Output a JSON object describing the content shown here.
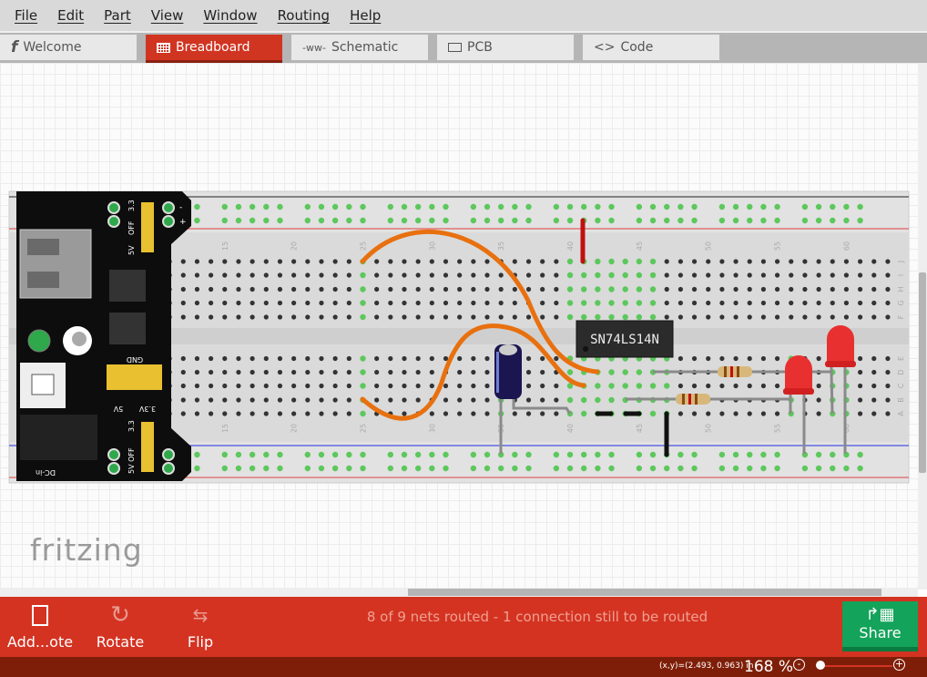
{
  "menu": [
    "File",
    "Edit",
    "Part",
    "View",
    "Window",
    "Routing",
    "Help"
  ],
  "tabs": [
    {
      "label": "Welcome",
      "icon": "fritzing-f-icon",
      "active": false
    },
    {
      "label": "Breadboard",
      "icon": "breadboard-icon",
      "active": true
    },
    {
      "label": "Schematic",
      "icon": "resistor-symbol-icon",
      "active": false
    },
    {
      "label": "PCB",
      "icon": "pcb-icon",
      "active": false
    },
    {
      "label": "Code",
      "icon": "code-brackets-icon",
      "active": false
    }
  ],
  "canvas": {
    "logo": "fritzing",
    "ic_label": "SN74LS14N",
    "column_numbers": [
      "15",
      "20",
      "25",
      "30",
      "35",
      "40",
      "45",
      "50",
      "55",
      "60"
    ],
    "rows_top": [
      "J",
      "I",
      "H",
      "G",
      "F"
    ],
    "rows_bottom": [
      "E",
      "D",
      "C",
      "B",
      "A"
    ],
    "power_module": {
      "labels": [
        "3.3",
        "OFF",
        "5V",
        "GND",
        "5V",
        "3.3V",
        "3.3",
        "5V OFF",
        "DC-in",
        "-",
        "+"
      ]
    }
  },
  "toolbar": {
    "add_note": "Add...ote",
    "rotate": "Rotate",
    "flip": "Flip",
    "status": "8 of 9 nets routed - 1 connection still to be routed",
    "share": "Share"
  },
  "statusbar": {
    "coords": "(x,y)=(2.493, 0.963) in",
    "zoom": "168 %"
  },
  "colors": {
    "accent": "#d43322",
    "share": "#14a35a",
    "statusbar": "#7f1e08",
    "wire_orange": "#e8700f"
  }
}
